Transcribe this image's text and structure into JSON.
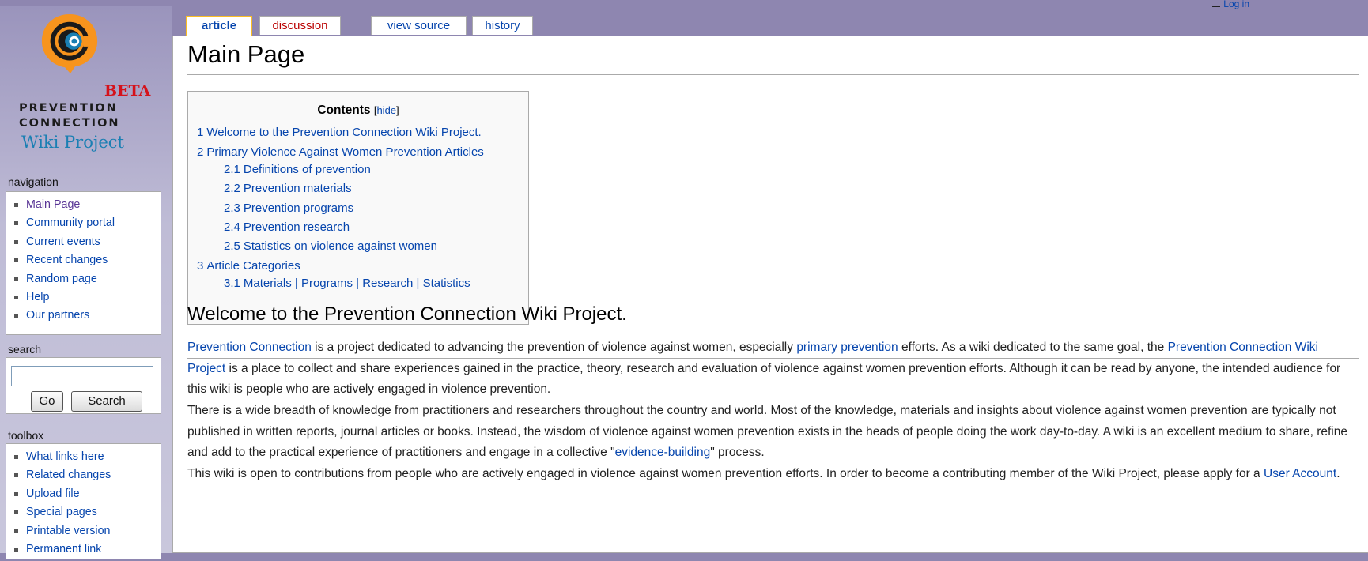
{
  "personal": {
    "text": "Log in"
  },
  "logo": {
    "beta": "BETA",
    "line1": "PREVENTION",
    "line2": "CONNECTION",
    "line3": "Wiki Project",
    "colors": {
      "orange": "#f7941d",
      "blue": "#1a7fb3",
      "red": "#d5121b"
    }
  },
  "navigation": {
    "heading": "navigation",
    "items": [
      {
        "label": "Main Page"
      },
      {
        "label": "Community portal"
      },
      {
        "label": "Current events"
      },
      {
        "label": "Recent changes"
      },
      {
        "label": "Random page"
      },
      {
        "label": "Help"
      },
      {
        "label": "Our partners"
      }
    ]
  },
  "search": {
    "heading": "search",
    "value": "",
    "go_label": "Go",
    "search_label": "Search"
  },
  "toolbox": {
    "heading": "toolbox",
    "items": [
      {
        "label": "What links here"
      },
      {
        "label": "Related changes"
      },
      {
        "label": "Upload file"
      },
      {
        "label": "Special pages"
      },
      {
        "label": "Printable version"
      },
      {
        "label": "Permanent link"
      }
    ]
  },
  "tabs": [
    {
      "label": "article",
      "active": true
    },
    {
      "label": "discussion",
      "active": false
    },
    {
      "label": "view source",
      "active": false
    },
    {
      "label": "history",
      "active": false
    }
  ],
  "page_title": "Main Page",
  "toc": {
    "title": "Contents",
    "toggle_open": "[",
    "toggle_label": "hide",
    "toggle_close": "]",
    "items": [
      {
        "num": "1",
        "text": "Welcome to the Prevention Connection Wiki Project."
      },
      {
        "num": "2",
        "text": "Primary Violence Against Women Prevention Articles"
      },
      {
        "num": "2.1",
        "text": "Definitions of prevention"
      },
      {
        "num": "2.2",
        "text": "Prevention materials"
      },
      {
        "num": "2.3",
        "text": "Prevention programs"
      },
      {
        "num": "2.4",
        "text": "Prevention research"
      },
      {
        "num": "2.5",
        "text": "Statistics on violence against women"
      },
      {
        "num": "3",
        "text": "Article Categories"
      },
      {
        "num": "3.1",
        "text": "Materials | Programs | Research | Statistics"
      }
    ]
  },
  "section1": {
    "heading": "Welcome to the Prevention Connection Wiki Project.",
    "p1": {
      "link1": "Prevention Connection",
      "t1": " is a project dedicated to advancing the prevention of violence against women, especially ",
      "link2": "primary prevention",
      "t2": " efforts. As a wiki dedicated to the same goal, the ",
      "link3": "Prevention Connection Wiki Project",
      "t3": " is a place to collect and share experiences gained in the practice, theory, research and evaluation of violence against women prevention efforts. Although it can be read by anyone, the intended audience for this wiki is people who are actively engaged in violence prevention."
    },
    "p2": {
      "t1": "There is a wide breadth of knowledge from practitioners and researchers throughout the country and world. Most of the knowledge, materials and insights about violence against women prevention are typically not published in written reports, journal articles or books. Instead, the wisdom of violence against women prevention exists in the heads of people doing the work day-to-day. A wiki is an excellent medium to share, refine and add to the practical experience of practitioners and engage in a collective \"",
      "link1": "evidence-building",
      "t2": "\" process."
    },
    "p3": {
      "t1": "This wiki is open to contributions from people who are actively engaged in violence against women prevention efforts. In order to become a contributing member of the Wiki Project, please apply for a ",
      "link1": "User Account",
      "t2": "."
    }
  }
}
